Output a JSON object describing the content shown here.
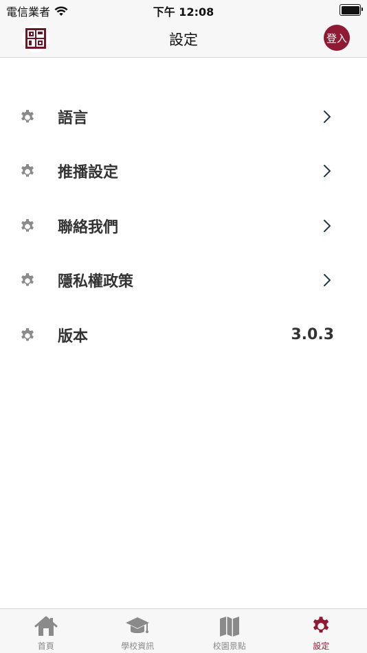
{
  "status_bar": {
    "carrier": "電信業者",
    "time": "下午 12:08"
  },
  "nav": {
    "title": "設定",
    "login_label": "登入"
  },
  "settings": {
    "items": [
      {
        "label": "語言",
        "icon": "gear-icon",
        "accessory": "chevron"
      },
      {
        "label": "推播設定",
        "icon": "gear-icon",
        "accessory": "chevron"
      },
      {
        "label": "聯絡我們",
        "icon": "gear-icon",
        "accessory": "chevron"
      },
      {
        "label": "隱私權政策",
        "icon": "gear-icon",
        "accessory": "chevron"
      },
      {
        "label": "版本",
        "icon": "gear-icon",
        "accessory": "value",
        "value": "3.0.3"
      }
    ]
  },
  "tabs": [
    {
      "label": "首頁",
      "icon": "home-icon",
      "active": false
    },
    {
      "label": "學校資訊",
      "icon": "graduation-cap-icon",
      "active": false
    },
    {
      "label": "校園景點",
      "icon": "map-icon",
      "active": false
    },
    {
      "label": "設定",
      "icon": "gear-icon",
      "active": true
    }
  ],
  "colors": {
    "accent": "#8e1b33",
    "icon_gray": "#8a8a8a",
    "chevron": "#1f3a4a",
    "bar_background": "#f7f7f7"
  }
}
